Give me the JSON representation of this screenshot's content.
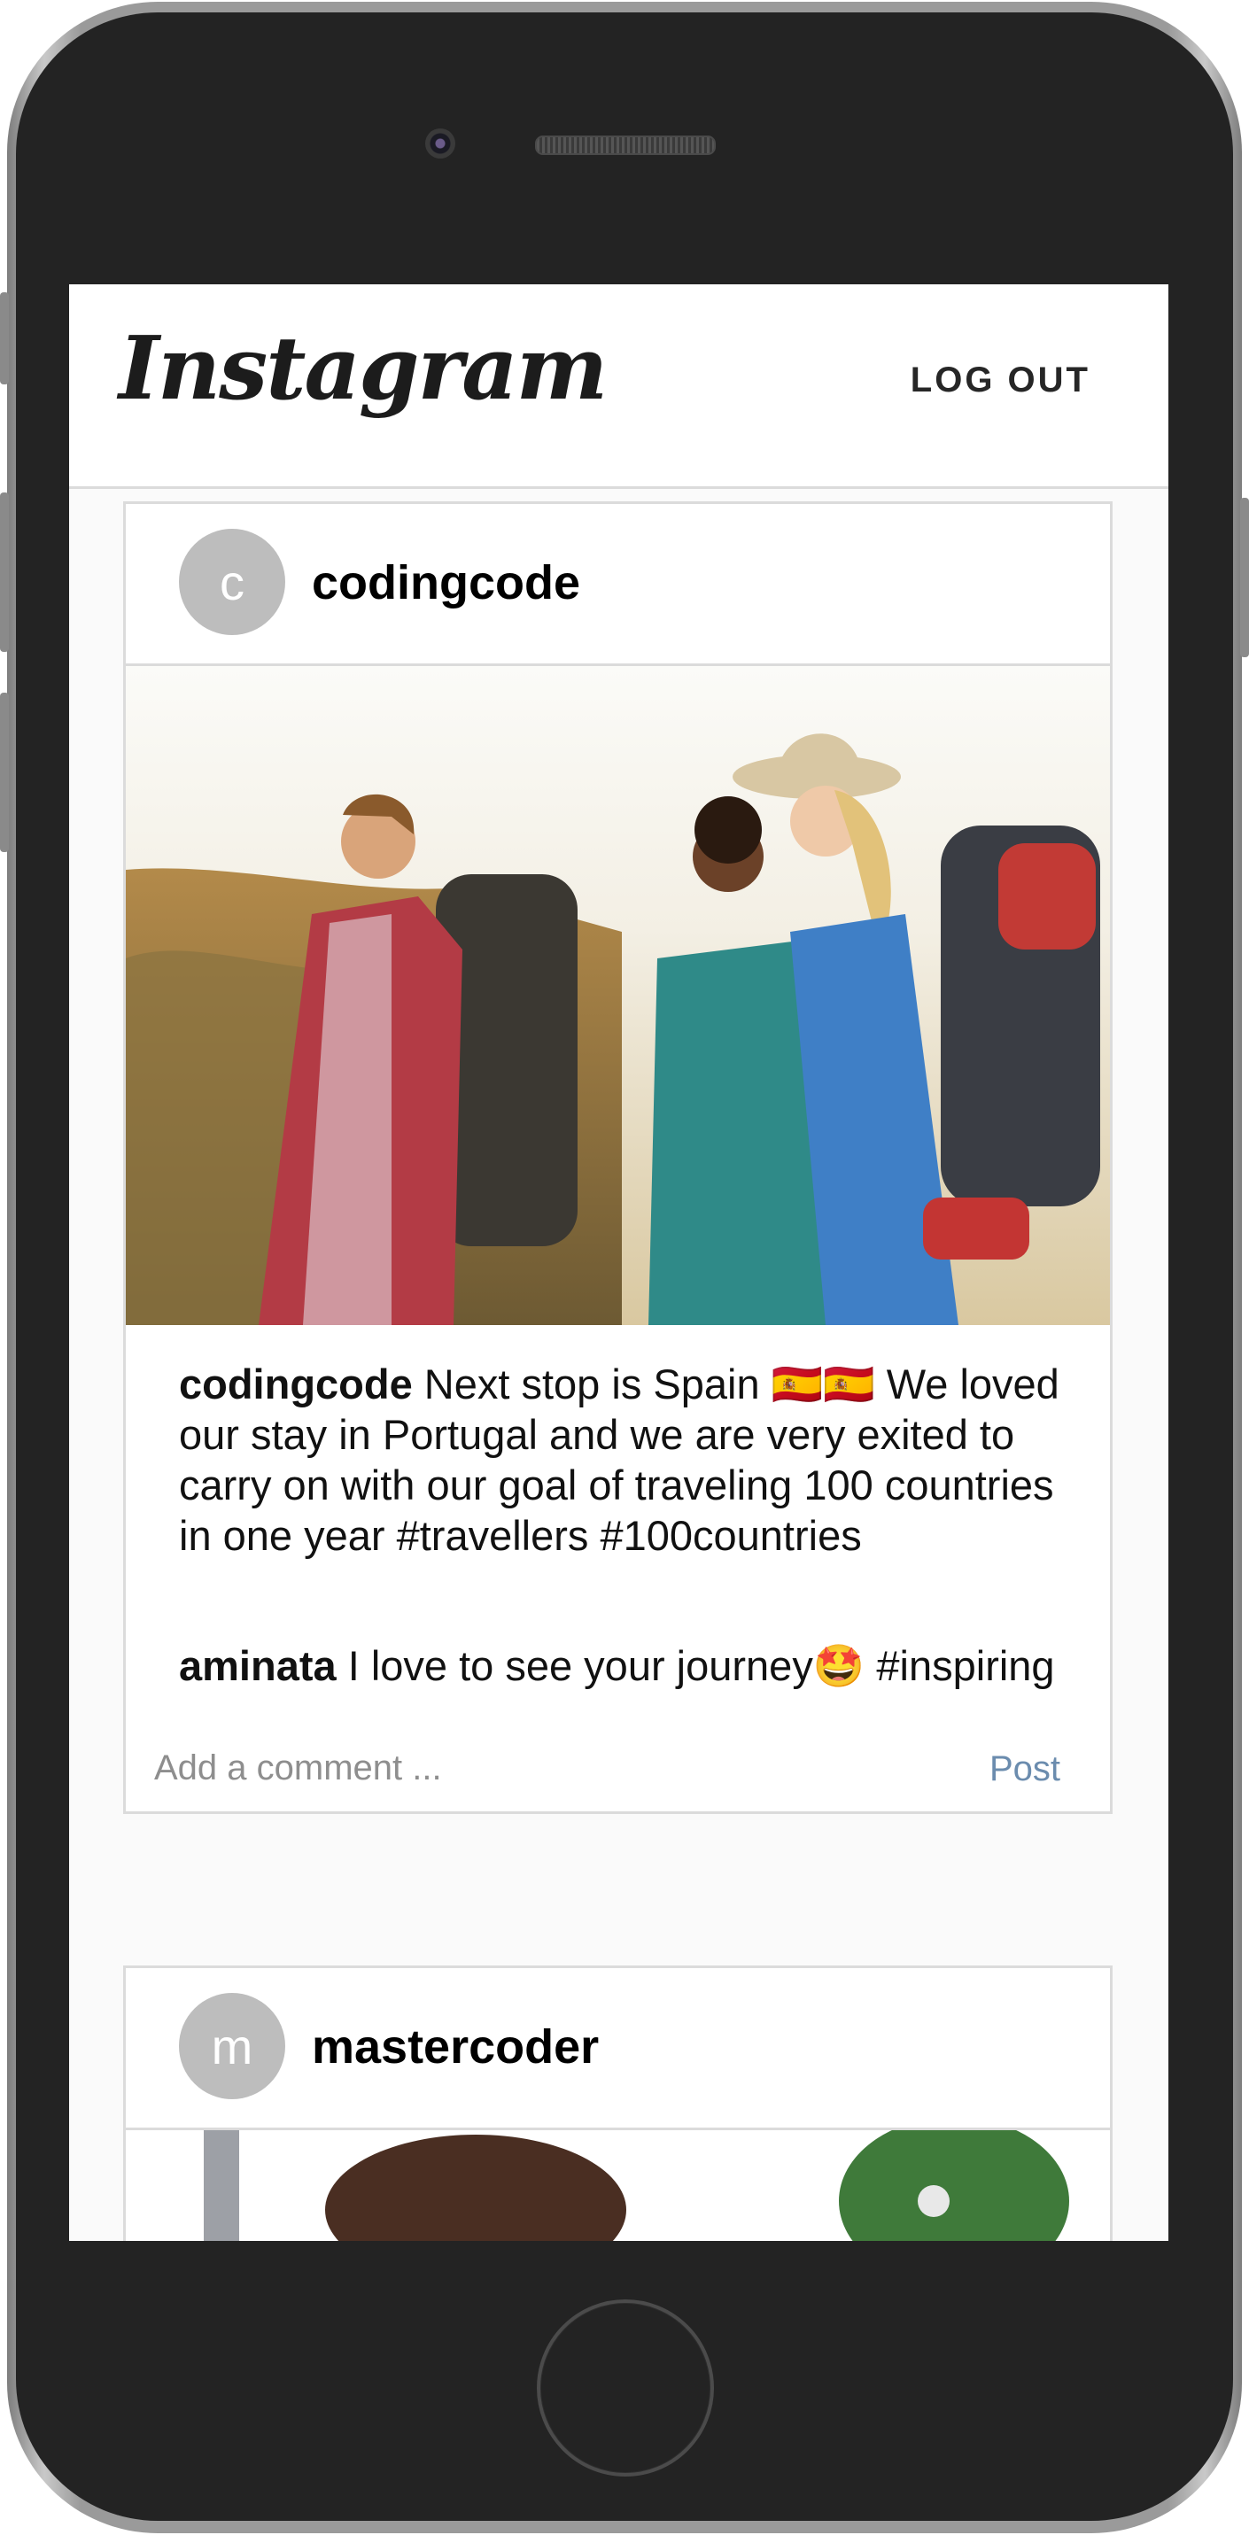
{
  "app": {
    "logo_text": "Instagram",
    "logout_label": "LOG OUT"
  },
  "posts": [
    {
      "avatar_letter": "c",
      "username": "codingcode",
      "image_icon": "travellers-photo",
      "caption_user": "codingcode",
      "caption_text": " Next stop is Spain 🇪🇸🇪🇸 We loved our stay in Portugal and we are very exited to carry on with our goal of traveling 100 countries in one year #travellers #100countries",
      "comments": [
        {
          "user": "aminata",
          "text": " I love to see your journey🤩 #inspiring"
        }
      ],
      "comment_placeholder": "Add a comment ...",
      "post_label": "Post"
    },
    {
      "avatar_letter": "m",
      "username": "mastercoder",
      "image_icon": "portrait-photo"
    }
  ],
  "colors": {
    "screen_bg": "#fafafa",
    "border": "#dbdbdb",
    "avatar_bg": "#bdbdbd",
    "post_button": "#6b8cae",
    "phone_body": "#232323"
  }
}
